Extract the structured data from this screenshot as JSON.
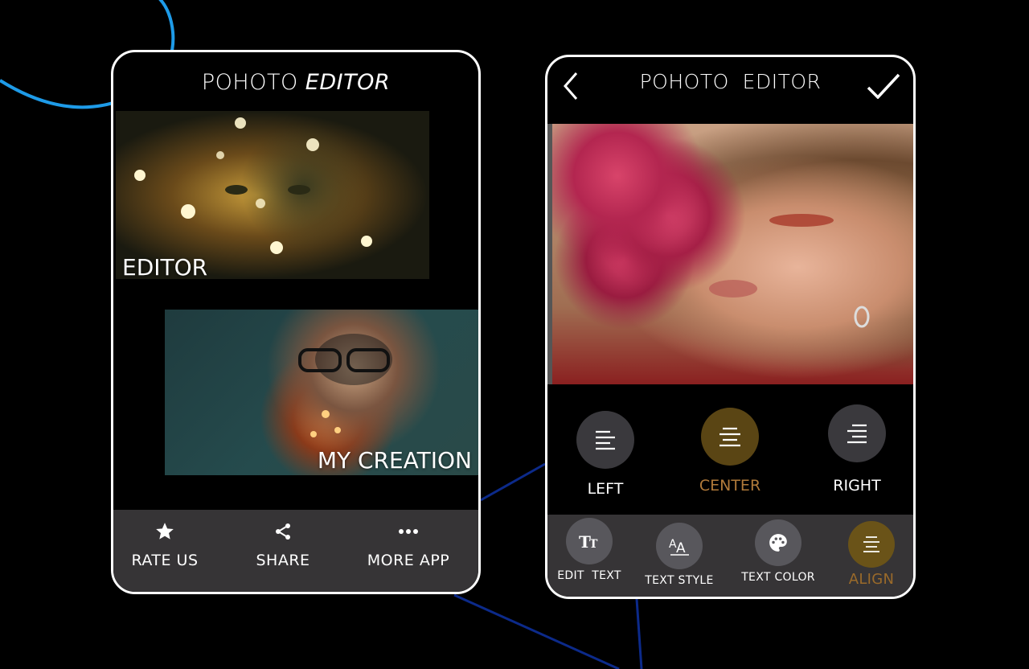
{
  "left_screen": {
    "title_main": "POHOTO",
    "title_italic": "EDITOR",
    "editor_card_label": "EDITOR",
    "creation_card_label": "MY CREATION",
    "bottom_bar": {
      "rate_us": "RATE US",
      "share": "SHARE",
      "more_app": "MORE APP"
    }
  },
  "right_screen": {
    "title": "POHOTO  EDITOR",
    "align_options": {
      "left": "LEFT",
      "center": "CENTER",
      "right": "RIGHT"
    },
    "selected_alignment": "CENTER",
    "tools": {
      "edit_text": "EDIT  TEXT",
      "text_style": "TEXT STYLE",
      "text_color": "TEXT COLOR",
      "align": "ALIGN"
    },
    "active_tool": "ALIGN"
  },
  "colors": {
    "background": "#000000",
    "bar": "#363436",
    "accent_gold": "#b07a3a",
    "active_circle": "#5a4514",
    "deco_blue_arc": "#1e9be8",
    "deco_dark_blue_lines": "#0c2a8a"
  }
}
